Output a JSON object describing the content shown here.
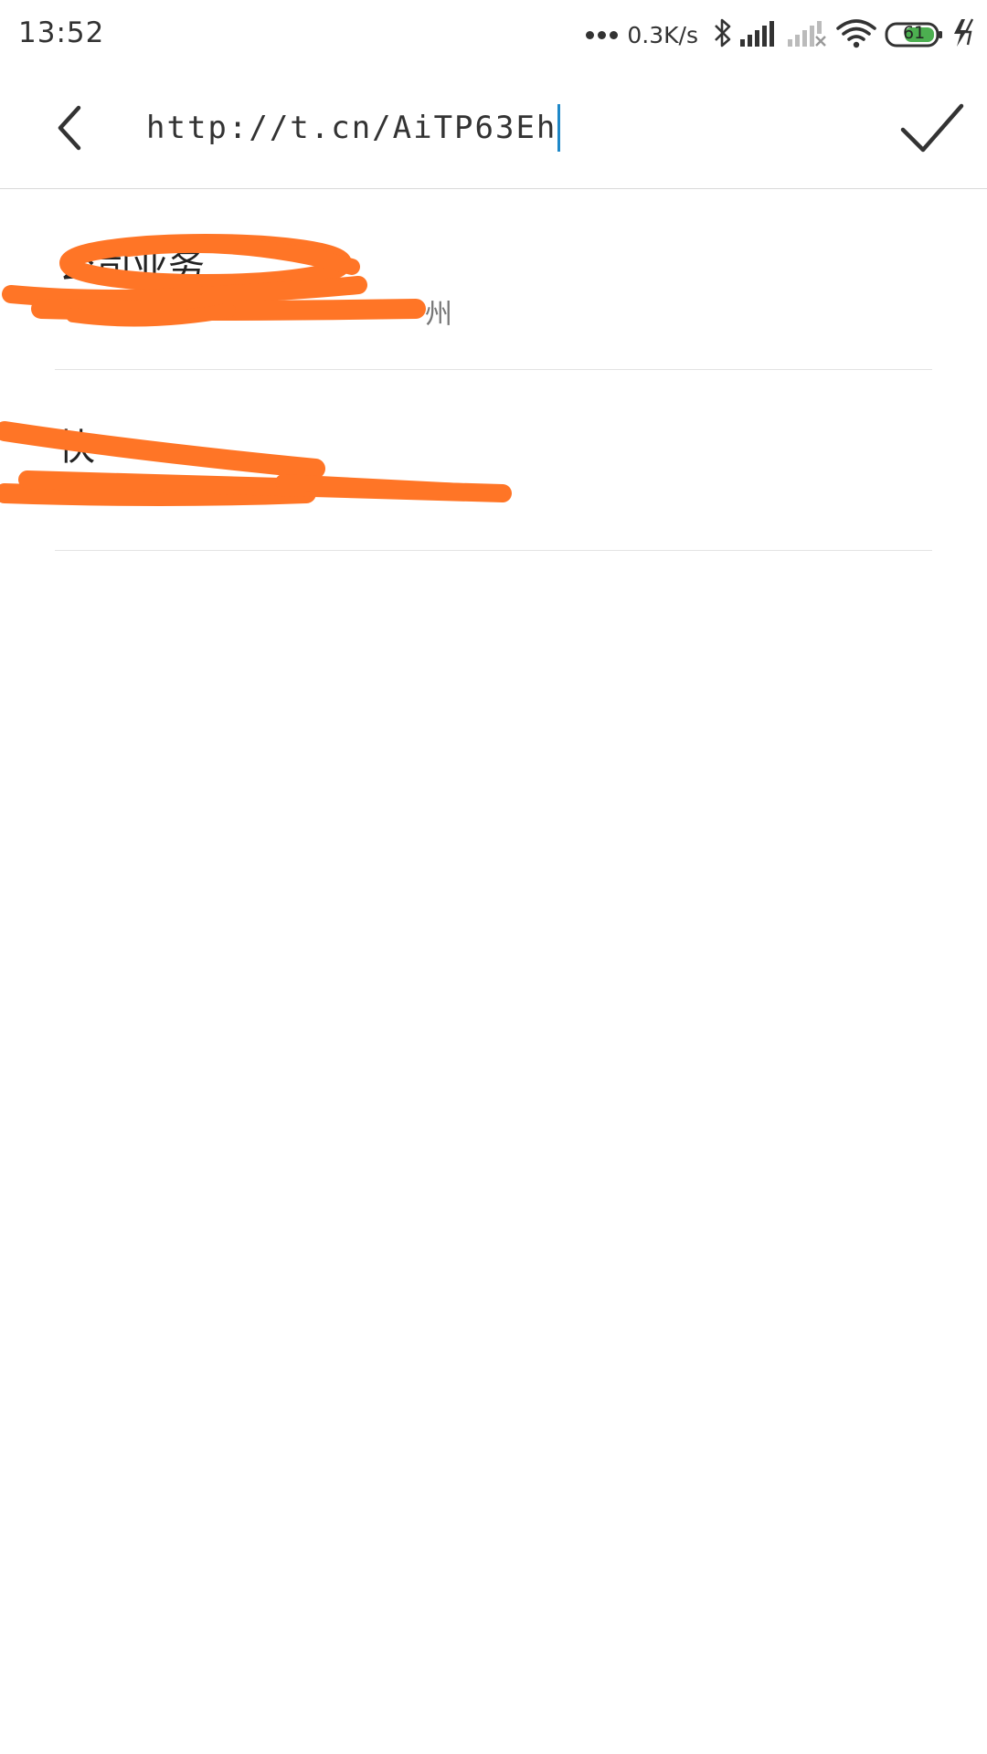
{
  "status_bar": {
    "time": "13:52",
    "network_speed": "0.3K/s",
    "battery_level": "61",
    "icons": [
      "more-dots-icon",
      "bluetooth-icon",
      "signal-icon",
      "signal-no-service-icon",
      "wifi-icon",
      "battery-icon",
      "charging-icon"
    ],
    "battery_color": "#4caf50"
  },
  "app_bar": {
    "url_value": "http://t.cn/AiTP63Eh",
    "back_icon": "chevron-left-icon",
    "confirm_icon": "checkmark-icon",
    "caret_color": "#1e88c8"
  },
  "results": [
    {
      "title": "公司业务",
      "subtitle": "州"
    },
    {
      "title": "快",
      "subtitle": ""
    }
  ],
  "colors": {
    "redaction": "#ff7526",
    "divider": "#e3e3e3",
    "text_primary": "#222222",
    "text_secondary": "#777777"
  }
}
